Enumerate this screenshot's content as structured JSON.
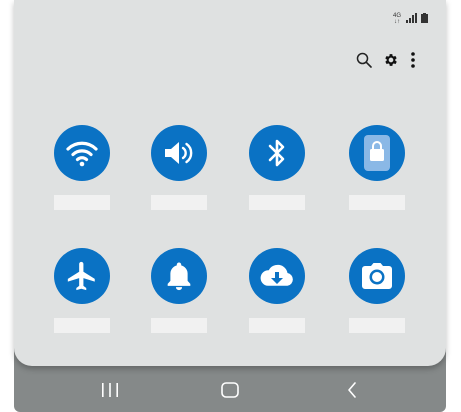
{
  "status_bar": {
    "network_line1": "4G",
    "network_line2": "↓↑",
    "signal_icon": "signal-bars-icon",
    "battery_icon": "battery-icon"
  },
  "toolbar": {
    "icons": [
      "search-icon",
      "gear-icon",
      "more-vert-icon"
    ]
  },
  "quick_settings": {
    "tiles": [
      {
        "icon": "wifi-icon",
        "label": ""
      },
      {
        "icon": "volume-icon",
        "label": ""
      },
      {
        "icon": "bluetooth-icon",
        "label": ""
      },
      {
        "icon": "shopping-bag-icon",
        "label": ""
      },
      {
        "icon": "airplane-icon",
        "label": ""
      },
      {
        "icon": "bell-icon",
        "label": ""
      },
      {
        "icon": "cloud-download-icon",
        "label": ""
      },
      {
        "icon": "camera-icon",
        "label": ""
      }
    ]
  },
  "navigation_bar": {
    "icons": [
      "recents-icon",
      "home-icon",
      "back-icon"
    ]
  },
  "colors": {
    "accent": "#0a72c4",
    "panel": "#dfe1e1",
    "nav_bar": "#858989",
    "label_placeholder": "#f1f1f1"
  }
}
